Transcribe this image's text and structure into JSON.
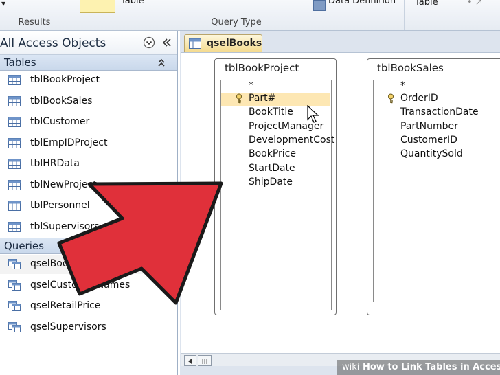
{
  "ribbon": {
    "results_label": "Results",
    "table_button_label": "Table",
    "query_type_label": "Query Type",
    "data_definition_label": "Data Definition",
    "table_right_label": "Table"
  },
  "nav": {
    "title": "All Access Objects",
    "tables_header": "Tables",
    "tables": [
      "tblBookProject",
      "tblBookSales",
      "tblCustomer",
      "tblEmpIDProject",
      "tblHRData",
      "tblNewProject",
      "tblPersonnel",
      "tblSupervisors"
    ],
    "queries_header": "Queries",
    "queries": [
      "qselBooks",
      "qselCustomerNames",
      "qselRetailPrice",
      "qselSupervisors"
    ]
  },
  "tab": {
    "label": "qselBooks"
  },
  "field_lists": [
    {
      "title": "tblBookProject",
      "fields": [
        "*",
        "Part#",
        "BookTitle",
        "ProjectManager",
        "DevelopmentCost",
        "BookPrice",
        "StartDate",
        "ShipDate"
      ]
    },
    {
      "title": "tblBookSales",
      "fields": [
        "*",
        "OrderID",
        "TransactionDate",
        "PartNumber",
        "CustomerID",
        "QuantitySold"
      ]
    }
  ],
  "watermark": {
    "brand": "wiki",
    "text": "How to Link Tables in Access"
  },
  "colors": {
    "arrow_fill": "#e0303a",
    "tab_fill": "#f4d98a",
    "section_header": "#c9d8eb"
  }
}
